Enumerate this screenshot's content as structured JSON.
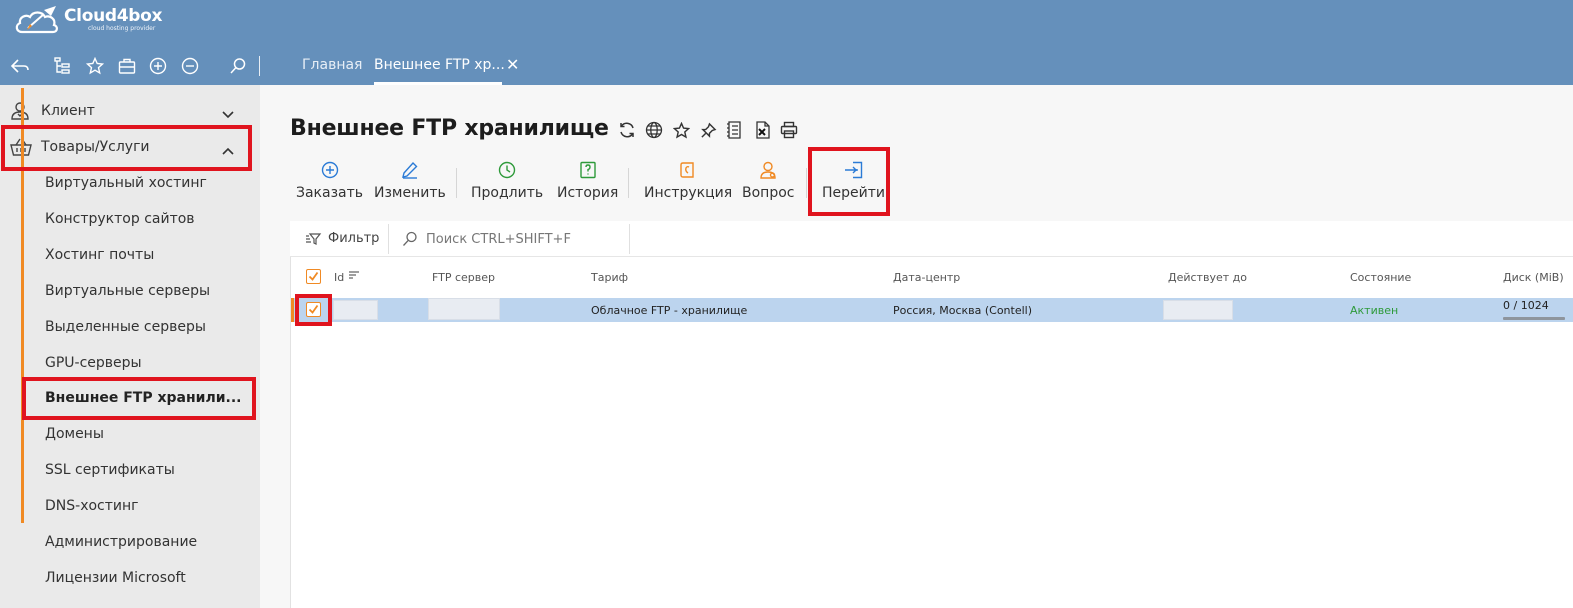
{
  "app": {
    "name": "Cloud4box",
    "tagline": "cloud hosting provider",
    "accent": "#f08a24",
    "topbar_color": "#6590bb",
    "highlight_color": "#e0141e"
  },
  "toolbar": {
    "icons": [
      "back-arrow-icon",
      "tree-icon",
      "star-icon",
      "briefcase-icon",
      "plus-circle-icon",
      "minus-circle-icon",
      "search-icon"
    ]
  },
  "tabs": [
    {
      "label": "Главная",
      "active": false
    },
    {
      "label": "Внешнее FTP хр...",
      "active": true
    }
  ],
  "tab_close": "✕",
  "sidebar": {
    "sections": [
      {
        "label": "Клиент",
        "expanded": false
      },
      {
        "label": "Товары/Услуги",
        "expanded": true
      }
    ],
    "items": [
      {
        "label": "Виртуальный хостинг"
      },
      {
        "label": "Конструктор сайтов"
      },
      {
        "label": "Хостинг почты"
      },
      {
        "label": "Виртуальные серверы"
      },
      {
        "label": "Выделенные серверы"
      },
      {
        "label": "GPU-серверы"
      },
      {
        "label": "Внешнее FTP хранили..."
      },
      {
        "label": "Домены"
      },
      {
        "label": "SSL сертификаты"
      },
      {
        "label": "DNS-хостинг"
      },
      {
        "label": "Администрирование"
      },
      {
        "label": "Лицензии Microsoft"
      }
    ],
    "active_index": 6
  },
  "page": {
    "title": "Внешнее FTP хранилище",
    "title_icons": [
      "refresh-icon",
      "globe-icon",
      "star-icon",
      "pin-icon",
      "document-list-icon",
      "excel-icon",
      "print-icon"
    ]
  },
  "actions": [
    {
      "label": "Заказать",
      "icon": "plus-circle-icon",
      "color": "#2b7bd6"
    },
    {
      "label": "Изменить",
      "icon": "pencil-icon",
      "color": "#2b7bd6"
    },
    {
      "label": "Продлить",
      "icon": "clock-icon",
      "color": "#2e9a3a"
    },
    {
      "label": "История",
      "icon": "history-icon",
      "color": "#2e9a3a"
    },
    {
      "label": "Инструкция",
      "icon": "manual-icon",
      "color": "#f08a24"
    },
    {
      "label": "Вопрос",
      "icon": "support-icon",
      "color": "#f08a24"
    },
    {
      "label": "Перейти",
      "icon": "enter-icon",
      "color": "#2b7bd6"
    }
  ],
  "filterbar": {
    "filter_label": "Фильтр",
    "search_placeholder": "Поиск CTRL+SHIFT+F"
  },
  "table": {
    "columns": [
      "Id",
      "FTP сервер",
      "Тариф",
      "Дата-центр",
      "Действует до",
      "Состояние",
      "Диск (MiB)"
    ],
    "rows": [
      {
        "id": "",
        "ftp_server": "",
        "tariff": "Облачное FTP - хранилище",
        "datacenter": "Россия, Москва (Contell)",
        "valid_until": "",
        "status": "Активен",
        "disk": "0 / 1024",
        "disk_used_fraction": 0,
        "checked": true
      }
    ],
    "header_checked": true
  }
}
